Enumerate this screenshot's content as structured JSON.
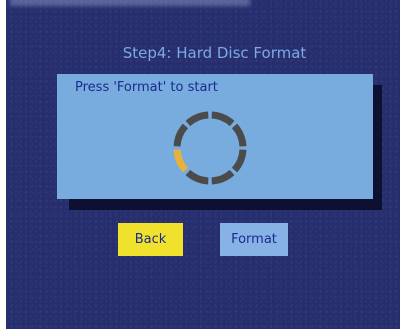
{
  "dialog": {
    "title": "Step4: Hard Disc Format",
    "message": "Press 'Format' to start"
  },
  "progress": {
    "segments_total": 8,
    "segments_active": 1,
    "active_color": "#e8b23a",
    "inactive_color": "#4b4b4b"
  },
  "buttons": {
    "back_label": "Back",
    "format_label": "Format",
    "focused": "back"
  },
  "colors": {
    "background": "#262e6e",
    "title": "#7ea8e6",
    "panel": "#78acdf",
    "button_focus": "#f0e22c",
    "button_normal": "#86b2e6",
    "text_dark": "#1c2a8e"
  }
}
